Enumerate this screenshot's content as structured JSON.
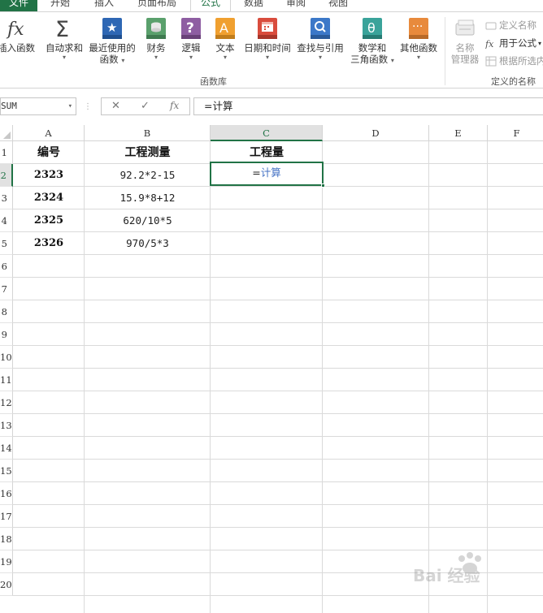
{
  "tabs": [
    {
      "label": "文件"
    },
    {
      "label": "开始"
    },
    {
      "label": "插入"
    },
    {
      "label": "页面布局"
    },
    {
      "label": "公式"
    },
    {
      "label": "数据"
    },
    {
      "label": "审阅"
    },
    {
      "label": "视图"
    }
  ],
  "ribbon": {
    "insert_function": "插入函数",
    "autosum": "自动求和",
    "recent_line1": "最近使用的",
    "recent_line2": "函数",
    "finance": "财务",
    "logic": "逻辑",
    "text": "文本",
    "datetime": "日期和时间",
    "lookup": "查找与引用",
    "math_line1": "数学和",
    "math_line2": "三角函数",
    "other": "其他函数",
    "group_library": "函数库",
    "name_manager_line1": "名称",
    "name_manager_line2": "管理器",
    "define_name": "定义名称",
    "use_in_formula": "用于公式",
    "create_from_selection": "根据所选内",
    "group_defined_names": "定义的名称",
    "icon_colors": {
      "finance": "#5aa06c",
      "logic": "#8e5ea2",
      "text": "#f0a030",
      "datetime": "#d94c3d",
      "lookup": "#3c78c8",
      "math": "#3aa39a",
      "other": "#e88a3c",
      "recent": "#2e67b4"
    }
  },
  "formula_bar": {
    "name_box": "SUM",
    "cancel_icon": "✕",
    "enter_icon": "✓",
    "fx_icon": "fx",
    "content": "=计算"
  },
  "columns": [
    "A",
    "B",
    "C",
    "D",
    "E",
    "F"
  ],
  "rows": [
    "1",
    "2",
    "3",
    "4",
    "5",
    "6",
    "7",
    "8",
    "9",
    "10",
    "11",
    "12",
    "13",
    "14",
    "15",
    "16",
    "17",
    "18",
    "19",
    "20"
  ],
  "sheet": {
    "headers": {
      "a": "编号",
      "b": "工程测量",
      "c": "工程量"
    },
    "data": [
      {
        "id": "2323",
        "expr": "92.2*2-15"
      },
      {
        "id": "2324",
        "expr": "15.9*8+12"
      },
      {
        "id": "2325",
        "expr": "620/10*5"
      },
      {
        "id": "2326",
        "expr": "970/5*3"
      }
    ],
    "active_cell": {
      "eq": "=",
      "fn": "计算"
    }
  },
  "watermark": {
    "text": "Bai 经验"
  },
  "colors": {
    "accent": "#217346",
    "formula_fn": "#4472c4"
  }
}
